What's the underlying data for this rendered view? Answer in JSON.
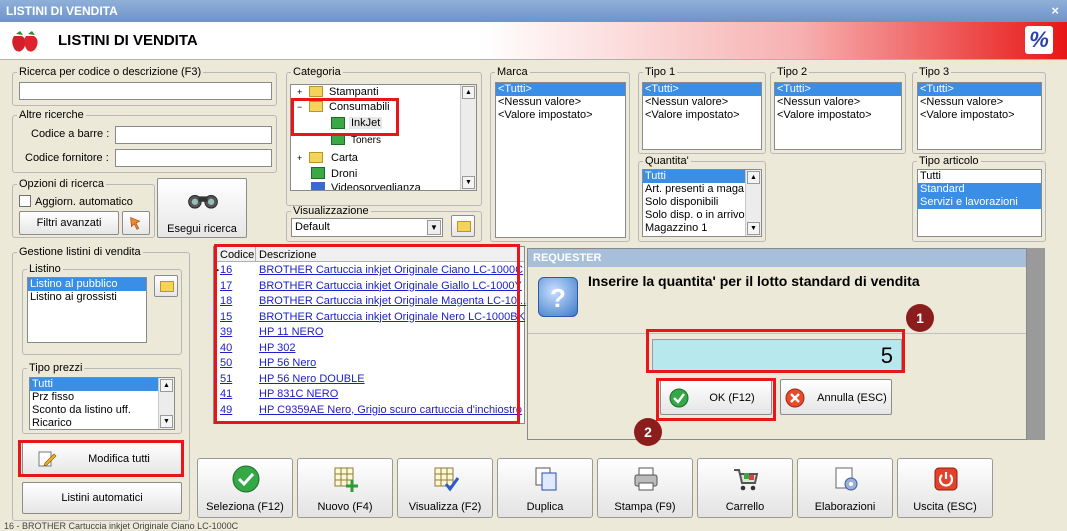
{
  "window": {
    "title": "LISTINI DI VENDITA",
    "close": "×"
  },
  "header": {
    "title": "LISTINI DI VENDITA",
    "badge": "%"
  },
  "search": {
    "legend": "Ricerca per codice o descrizione (F3)",
    "value": ""
  },
  "altre": {
    "legend": "Altre ricerche",
    "barcode_label": "Codice a barre :",
    "supplier_label": "Codice fornitore :"
  },
  "opzioni": {
    "legend": "Opzioni di ricerca",
    "auto_update": "Aggiorn. automatico",
    "advanced_filters": "Filtri avanzati",
    "search_button": "Esegui ricerca"
  },
  "categoria": {
    "legend": "Categoria",
    "items": [
      "Stampanti",
      "Consumabili",
      "InkJet",
      "Toners",
      "Carta",
      "Droni",
      "Videosorveglianza"
    ]
  },
  "visualizzazione": {
    "legend": "Visualizzazione",
    "selected": "Default"
  },
  "marca": {
    "legend": "Marca",
    "items": [
      "<Tutti>",
      "<Nessun valore>",
      "<Valore impostato>"
    ]
  },
  "tipo1": {
    "legend": "Tipo 1",
    "items": [
      "<Tutti>",
      "<Nessun valore>",
      "<Valore impostato>"
    ]
  },
  "tipo2": {
    "legend": "Tipo 2",
    "items": [
      "<Tutti>",
      "<Nessun valore>",
      "<Valore impostato>"
    ]
  },
  "tipo3": {
    "legend": "Tipo 3",
    "items": [
      "<Tutti>",
      "<Nessun valore>",
      "<Valore impostato>"
    ]
  },
  "quantita": {
    "legend": "Quantita'",
    "items": [
      "Tutti",
      "Art. presenti a maga",
      "Solo disponibili",
      "Solo disp. o in arrivo",
      "Magazzino 1"
    ]
  },
  "tipo_articolo": {
    "legend": "Tipo articolo",
    "items": [
      "Tutti",
      "Standard",
      "Servizi e lavorazioni"
    ]
  },
  "gestione": {
    "legend": "Gestione listini di vendita",
    "listino_legend": "Listino",
    "listini": [
      "Listino al pubblico",
      "Listino ai grossisti"
    ]
  },
  "tipo_prezzi": {
    "legend": "Tipo prezzi",
    "items": [
      "Tutti",
      "Prz fisso",
      "Sconto da listino uff.",
      "Ricarico"
    ]
  },
  "modifica_tutti": "Modifica tutti",
  "listini_automatici": "Listini automatici",
  "grid": {
    "headers": {
      "code": "Codice",
      "description": "Descrizione"
    },
    "rows": [
      {
        "code": "16",
        "desc": "BROTHER Cartuccia inkjet Originale Ciano LC-1000C"
      },
      {
        "code": "17",
        "desc": "BROTHER Cartuccia inkjet Originale Giallo LC-1000Y"
      },
      {
        "code": "18",
        "desc": "BROTHER Cartuccia inkjet Originale Magenta LC-10..."
      },
      {
        "code": "15",
        "desc": "BROTHER Cartuccia inkjet Originale Nero LC-1000BK"
      },
      {
        "code": "39",
        "desc": "HP 11 NERO"
      },
      {
        "code": "40",
        "desc": "HP 302"
      },
      {
        "code": "50",
        "desc": "HP 56 Nero"
      },
      {
        "code": "51",
        "desc": "HP 56 Nero DOUBLE"
      },
      {
        "code": "41",
        "desc": "HP 831C NERO"
      },
      {
        "code": "49",
        "desc": "HP C9359AE Nero, Grigio scuro cartuccia d'inchiostro"
      }
    ]
  },
  "requester": {
    "title": "REQUESTER",
    "message": "Inserire la quantita' per il lotto standard di vendita",
    "value": "5",
    "ok": "OK (F12)",
    "cancel": "Annulla (ESC)",
    "marker1": "1",
    "marker2": "2"
  },
  "toolbar": {
    "seleziona": "Seleziona (F12)",
    "nuovo": "Nuovo (F4)",
    "visualizza": "Visualizza (F2)",
    "duplica": "Duplica",
    "stampa": "Stampa (F9)",
    "carrello": "Carrello",
    "elaborazioni": "Elaborazioni",
    "uscita": "Uscita (ESC)"
  },
  "statusbar": "16 - BROTHER Cartuccia inkjet Originale Ciano LC-1000C",
  "colors": {
    "accent_red": "#e8151b",
    "selection_blue": "#3a8ee6",
    "link_blue": "#1c22c7",
    "qty_bg": "#b6e8ee"
  }
}
